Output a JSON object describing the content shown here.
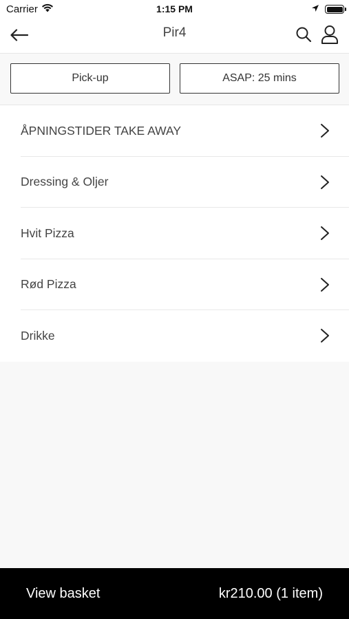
{
  "status": {
    "carrier": "Carrier",
    "time": "1:15 PM"
  },
  "header": {
    "title": "Pir4",
    "icons": [
      "back-arrow-icon",
      "search-icon",
      "account-icon"
    ]
  },
  "options": {
    "pickup_label": "Pick-up",
    "time_label": "ASAP: 25 mins"
  },
  "menu": {
    "items": [
      {
        "label": "ÅPNINGSTIDER TAKE AWAY"
      },
      {
        "label": "Dressing & Oljer"
      },
      {
        "label": "Hvit Pizza"
      },
      {
        "label": "Rød Pizza"
      },
      {
        "label": "Drikke"
      }
    ]
  },
  "basket": {
    "label": "View basket",
    "total": "kr210.00 (1 item)"
  },
  "colors": {
    "basket_bg": "#000000",
    "page_bg": "#f8f8f8",
    "text": "#444444"
  }
}
